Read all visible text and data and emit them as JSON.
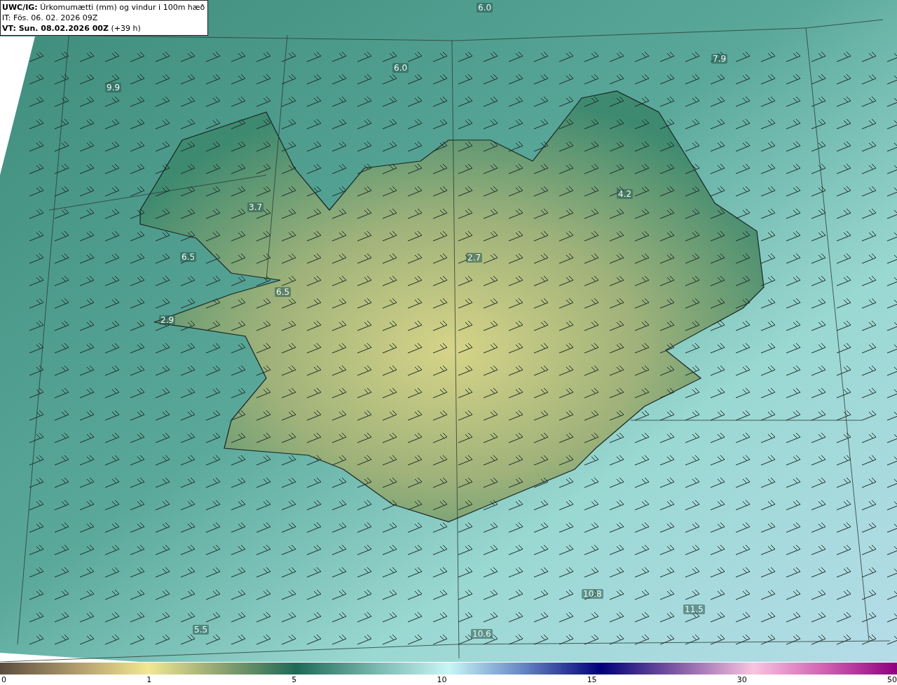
{
  "header": {
    "title": "**UWC/IG:** Úrkomumætti (mm) og vindur i 100m hæð",
    "issue_time": "IT: Fös. 06. 02. 2026 09Z",
    "valid_time": "**VT: Sun. 08.02.2026 00Z** (+39 h)"
  },
  "map_labels": [
    "6.0",
    "6.0",
    "7.9",
    "9.9",
    "3.7",
    "6.5",
    "6.5",
    "2.9",
    "2.7",
    "4.2",
    "5.5",
    "10.6",
    "10.8",
    "11.5"
  ],
  "colorbar": {
    "ticks": [
      "0",
      "1",
      "5",
      "10",
      "15",
      "30",
      "50"
    ]
  }
}
